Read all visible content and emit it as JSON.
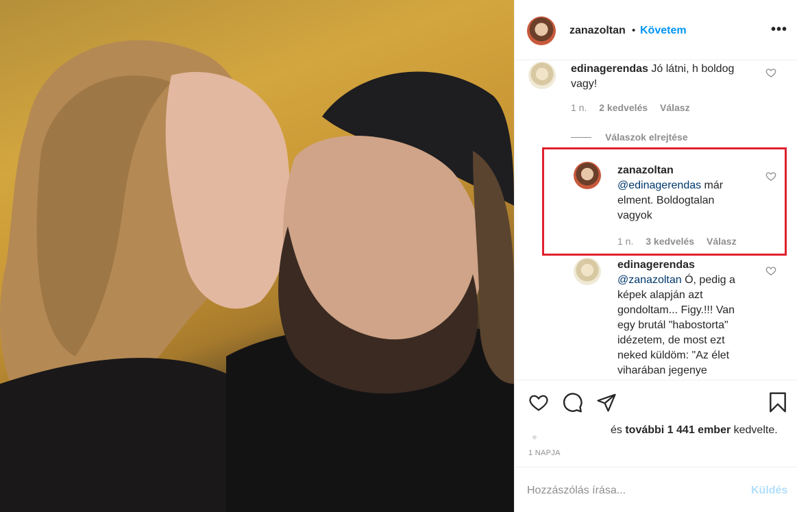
{
  "post": {
    "author": "zanazoltan",
    "separator": "•",
    "follow_label": "Követem",
    "more_icon": "more-horizontal-icon",
    "more_label": "•••"
  },
  "comments": [
    {
      "user": "edinagerendas",
      "text": "Jó látni, h boldog vagy!",
      "age": "1 n.",
      "likes": "2 kedvelés",
      "reply_label": "Válasz"
    }
  ],
  "replies_toggle": "Válaszok elrejtése",
  "replies": [
    {
      "user": "zanazoltan",
      "mention": "@edinagerendas",
      "text": " már elment. Boldogtalan vagyok",
      "age": "1 n.",
      "likes": "3 kedvelés",
      "reply_label": "Válasz",
      "highlighted": true,
      "highlight_color": "#e0202c"
    },
    {
      "user": "edinagerendas",
      "mention": "@zanazoltan",
      "text": " Ó, pedig a képek alapján azt gondoltam... Figy.!!! Van egy brutál \"habostorta\" idézetem, de most ezt neked küldöm: \"Az élet viharában jegenye"
    }
  ],
  "likes_line": {
    "prefix": "és ",
    "bold": "további 1 441 ember",
    "suffix": " kedvelte."
  },
  "date": "1 NAPJA",
  "comment_box": {
    "placeholder": "Hozzászólás írása...",
    "send_label": "Küldés"
  },
  "colors": {
    "link": "#0095f6",
    "mention": "#00376b",
    "muted": "#8e8e8e",
    "send_disabled": "#b2dffc",
    "highlight": "#e0202c"
  }
}
